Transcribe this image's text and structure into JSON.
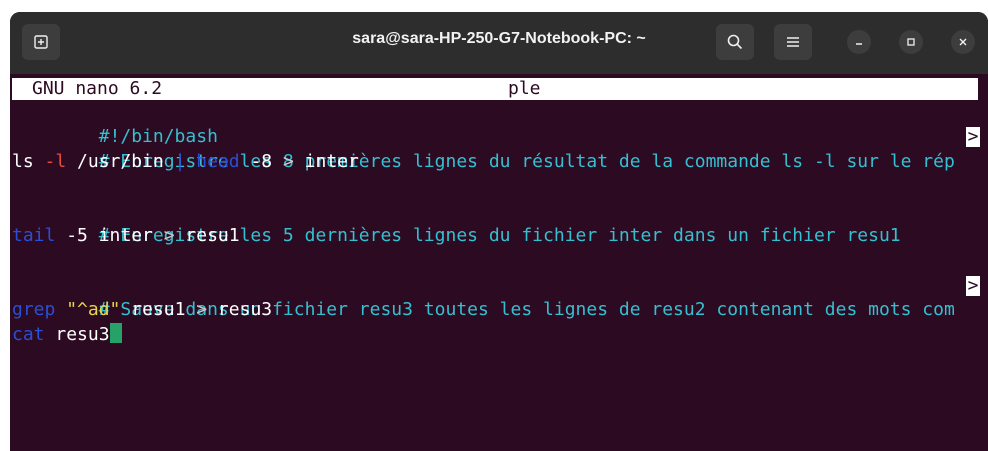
{
  "window": {
    "title": "sara@sara-HP-250-G7-Notebook-PC: ~",
    "buttons": {
      "new_tab_icon": "new-tab-icon",
      "search_icon": "search-icon",
      "menu_icon": "hamburger-menu-icon",
      "minimize_icon": "minimize-icon",
      "maximize_icon": "maximize-icon",
      "close_icon": "close-icon"
    }
  },
  "nano": {
    "version": "GNU nano 6.2",
    "filename": "ple",
    "truncation_marker": ">"
  },
  "editor": {
    "line1": "#!/bin/bash",
    "line2": "# Enregistre les 8 premières lignes du résultat de la commande ls -l sur le rép",
    "line3": {
      "cmd": "ls ",
      "flag": "-l",
      "path": " /usr/bin ",
      "pipe": "|",
      "sp1": " ",
      "head": "head",
      "args": " -8 ",
      "redirect": ">",
      "target": " inter"
    },
    "line5": "# Enregistre les 5 dernières lignes du fichier inter dans un fichier resu1",
    "line6": {
      "tail": "tail",
      "args": " -5 inter ",
      "redirect": ">",
      "target": " resu1"
    },
    "line8": "# Sauve dans un fichier resu3 toutes les lignes de resu2 contenant des mots com",
    "line9": {
      "grep": "grep",
      "sp": " ",
      "pattern": "\"^ad\"",
      "args": " resu1 ",
      "redirect": ">",
      "target": " resu3"
    },
    "line10": {
      "cat": "cat",
      "args": " resu3"
    }
  },
  "colors": {
    "background": "#2c0a22",
    "comment": "#34c0d0",
    "keyword": "#2a4fd6",
    "string": "#e8d44a",
    "cursor": "#26a269"
  }
}
